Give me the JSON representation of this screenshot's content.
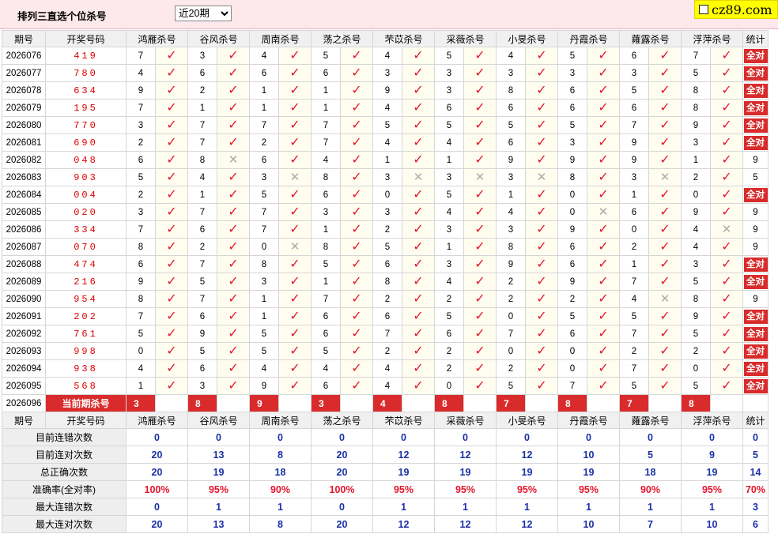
{
  "header": {
    "title": "排列三直选个位杀号",
    "period_select": "近20期",
    "logo_text": "cz89.com"
  },
  "table": {
    "headers": [
      "期号",
      "开奖号码",
      "鸿雁杀号",
      "谷风杀号",
      "周南杀号",
      "荡之杀号",
      "芣苡杀号",
      "采薇杀号",
      "小旻杀号",
      "丹霞杀号",
      "蕹露杀号",
      "浮萍杀号",
      "统计"
    ],
    "all_correct_label": "全对",
    "current_row": {
      "issue": "2026096",
      "label": "当前期杀号",
      "values": [
        "3",
        "8",
        "9",
        "3",
        "4",
        "8",
        "7",
        "8",
        "7",
        "8"
      ]
    },
    "rows": [
      {
        "issue": "2026076",
        "draw": "419",
        "kills": [
          "7",
          "3",
          "4",
          "5",
          "4",
          "5",
          "4",
          "5",
          "6",
          "7"
        ],
        "hits": [
          1,
          1,
          1,
          1,
          1,
          1,
          1,
          1,
          1,
          1
        ],
        "stat": "全对"
      },
      {
        "issue": "2026077",
        "draw": "780",
        "kills": [
          "4",
          "6",
          "6",
          "6",
          "3",
          "3",
          "3",
          "3",
          "3",
          "5"
        ],
        "hits": [
          1,
          1,
          1,
          1,
          1,
          1,
          1,
          1,
          1,
          1
        ],
        "stat": "全对"
      },
      {
        "issue": "2026078",
        "draw": "634",
        "kills": [
          "9",
          "2",
          "1",
          "1",
          "9",
          "3",
          "8",
          "6",
          "5",
          "8"
        ],
        "hits": [
          1,
          1,
          1,
          1,
          1,
          1,
          1,
          1,
          1,
          1
        ],
        "stat": "全对"
      },
      {
        "issue": "2026079",
        "draw": "195",
        "kills": [
          "7",
          "1",
          "1",
          "1",
          "4",
          "6",
          "6",
          "6",
          "6",
          "8"
        ],
        "hits": [
          1,
          1,
          1,
          1,
          1,
          1,
          1,
          1,
          1,
          1
        ],
        "stat": "全对"
      },
      {
        "issue": "2026080",
        "draw": "770",
        "kills": [
          "3",
          "7",
          "7",
          "7",
          "5",
          "5",
          "5",
          "5",
          "7",
          "9"
        ],
        "hits": [
          1,
          1,
          1,
          1,
          1,
          1,
          1,
          1,
          1,
          1
        ],
        "stat": "全对"
      },
      {
        "issue": "2026081",
        "draw": "690",
        "kills": [
          "2",
          "7",
          "2",
          "7",
          "4",
          "4",
          "6",
          "3",
          "9",
          "3"
        ],
        "hits": [
          1,
          1,
          1,
          1,
          1,
          1,
          1,
          1,
          1,
          1
        ],
        "stat": "全对"
      },
      {
        "issue": "2026082",
        "draw": "048",
        "kills": [
          "6",
          "8",
          "6",
          "4",
          "1",
          "1",
          "9",
          "9",
          "9",
          "1"
        ],
        "hits": [
          1,
          0,
          1,
          1,
          1,
          1,
          1,
          1,
          1,
          1
        ],
        "stat": "9"
      },
      {
        "issue": "2026083",
        "draw": "903",
        "kills": [
          "5",
          "4",
          "3",
          "8",
          "3",
          "3",
          "3",
          "8",
          "3",
          "2"
        ],
        "hits": [
          1,
          1,
          0,
          1,
          0,
          0,
          0,
          1,
          0,
          1
        ],
        "stat": "5"
      },
      {
        "issue": "2026084",
        "draw": "004",
        "kills": [
          "2",
          "1",
          "5",
          "6",
          "0",
          "5",
          "1",
          "0",
          "1",
          "0"
        ],
        "hits": [
          1,
          1,
          1,
          1,
          1,
          1,
          1,
          1,
          1,
          1
        ],
        "stat": "全对"
      },
      {
        "issue": "2026085",
        "draw": "020",
        "kills": [
          "3",
          "7",
          "7",
          "3",
          "3",
          "4",
          "4",
          "0",
          "6",
          "9"
        ],
        "hits": [
          1,
          1,
          1,
          1,
          1,
          1,
          1,
          0,
          1,
          1
        ],
        "stat": "9"
      },
      {
        "issue": "2026086",
        "draw": "334",
        "kills": [
          "7",
          "6",
          "7",
          "1",
          "2",
          "3",
          "3",
          "9",
          "0",
          "4"
        ],
        "hits": [
          1,
          1,
          1,
          1,
          1,
          1,
          1,
          1,
          1,
          0
        ],
        "stat": "9"
      },
      {
        "issue": "2026087",
        "draw": "070",
        "kills": [
          "8",
          "2",
          "0",
          "8",
          "5",
          "1",
          "8",
          "6",
          "2",
          "4"
        ],
        "hits": [
          1,
          1,
          0,
          1,
          1,
          1,
          1,
          1,
          1,
          1
        ],
        "stat": "9"
      },
      {
        "issue": "2026088",
        "draw": "474",
        "kills": [
          "6",
          "7",
          "8",
          "5",
          "6",
          "3",
          "9",
          "6",
          "1",
          "3"
        ],
        "hits": [
          1,
          1,
          1,
          1,
          1,
          1,
          1,
          1,
          1,
          1
        ],
        "stat": "全对"
      },
      {
        "issue": "2026089",
        "draw": "216",
        "kills": [
          "9",
          "5",
          "3",
          "1",
          "8",
          "4",
          "2",
          "9",
          "7",
          "5"
        ],
        "hits": [
          1,
          1,
          1,
          1,
          1,
          1,
          1,
          1,
          1,
          1
        ],
        "stat": "全对"
      },
      {
        "issue": "2026090",
        "draw": "954",
        "kills": [
          "8",
          "7",
          "1",
          "7",
          "2",
          "2",
          "2",
          "2",
          "4",
          "8"
        ],
        "hits": [
          1,
          1,
          1,
          1,
          1,
          1,
          1,
          1,
          0,
          1
        ],
        "stat": "9"
      },
      {
        "issue": "2026091",
        "draw": "202",
        "kills": [
          "7",
          "6",
          "1",
          "6",
          "6",
          "5",
          "0",
          "5",
          "5",
          "9"
        ],
        "hits": [
          1,
          1,
          1,
          1,
          1,
          1,
          1,
          1,
          1,
          1
        ],
        "stat": "全对"
      },
      {
        "issue": "2026092",
        "draw": "761",
        "kills": [
          "5",
          "9",
          "5",
          "6",
          "7",
          "6",
          "7",
          "6",
          "7",
          "5"
        ],
        "hits": [
          1,
          1,
          1,
          1,
          1,
          1,
          1,
          1,
          1,
          1
        ],
        "stat": "全对"
      },
      {
        "issue": "2026093",
        "draw": "998",
        "kills": [
          "0",
          "5",
          "5",
          "5",
          "2",
          "2",
          "0",
          "0",
          "2",
          "2"
        ],
        "hits": [
          1,
          1,
          1,
          1,
          1,
          1,
          1,
          1,
          1,
          1
        ],
        "stat": "全对"
      },
      {
        "issue": "2026094",
        "draw": "938",
        "kills": [
          "4",
          "6",
          "4",
          "4",
          "4",
          "2",
          "2",
          "0",
          "7",
          "0"
        ],
        "hits": [
          1,
          1,
          1,
          1,
          1,
          1,
          1,
          1,
          1,
          1
        ],
        "stat": "全对"
      },
      {
        "issue": "2026095",
        "draw": "568",
        "kills": [
          "1",
          "3",
          "9",
          "6",
          "4",
          "0",
          "5",
          "7",
          "5",
          "5"
        ],
        "hits": [
          1,
          1,
          1,
          1,
          1,
          1,
          1,
          1,
          1,
          1
        ],
        "stat": "全对"
      }
    ],
    "summary": [
      {
        "label": "目前连错次数",
        "values": [
          "0",
          "0",
          "0",
          "0",
          "0",
          "0",
          "0",
          "0",
          "0",
          "0"
        ],
        "stat": "0"
      },
      {
        "label": "目前连对次数",
        "values": [
          "20",
          "13",
          "8",
          "20",
          "12",
          "12",
          "12",
          "10",
          "5",
          "9"
        ],
        "stat": "5"
      },
      {
        "label": "总正确次数",
        "values": [
          "20",
          "19",
          "18",
          "20",
          "19",
          "19",
          "19",
          "19",
          "18",
          "19"
        ],
        "stat": "14"
      },
      {
        "label": "准确率(全对率)",
        "values": [
          "100%",
          "95%",
          "90%",
          "100%",
          "95%",
          "95%",
          "95%",
          "95%",
          "90%",
          "95%"
        ],
        "stat": "70%",
        "is_rate": true
      },
      {
        "label": "最大连错次数",
        "values": [
          "0",
          "1",
          "1",
          "0",
          "1",
          "1",
          "1",
          "1",
          "1",
          "1"
        ],
        "stat": "3"
      },
      {
        "label": "最大连对次数",
        "values": [
          "20",
          "13",
          "8",
          "20",
          "12",
          "12",
          "12",
          "10",
          "7",
          "10"
        ],
        "stat": "6"
      }
    ]
  },
  "colors": {
    "accent_red": "#d92b2b",
    "check_red": "#e4162c",
    "summary_blue": "#1a2fa6"
  }
}
